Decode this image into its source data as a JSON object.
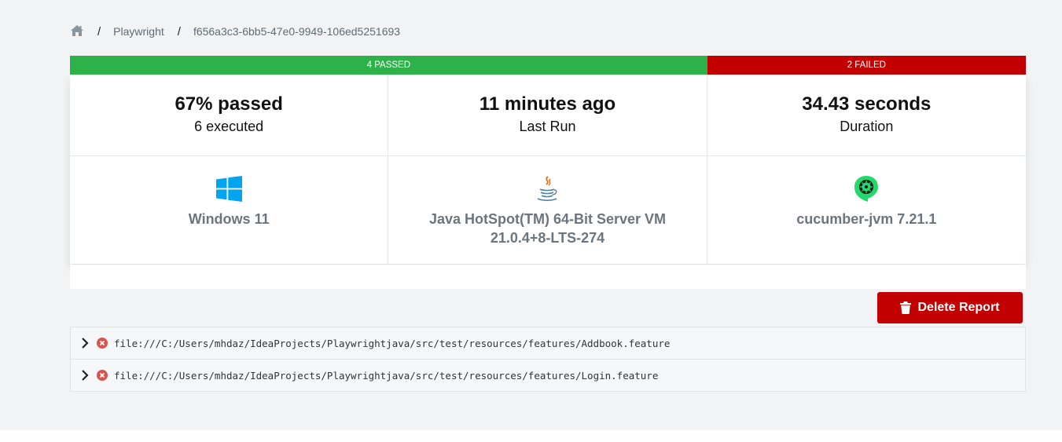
{
  "breadcrumb": {
    "home_icon": "home-icon",
    "project": "Playwright",
    "report_id": "f656a3c3-6bb5-47e0-9949-106ed5251693",
    "separator": "/"
  },
  "status_bar": {
    "passed_label": "4 PASSED",
    "failed_label": "2 FAILED",
    "passed_count": 4,
    "failed_count": 2,
    "passed_color": "#2db24a",
    "failed_color": "#c20000"
  },
  "stats": {
    "pass_rate": "67% passed",
    "executed": "6 executed",
    "last_run": "11 minutes ago",
    "last_run_label": "Last Run",
    "duration": "34.43 seconds",
    "duration_label": "Duration"
  },
  "environment": {
    "os": {
      "icon": "windows-icon",
      "label": "Windows 11"
    },
    "jvm": {
      "icon": "java-icon",
      "label": "Java HotSpot(TM) 64-Bit Server VM",
      "version": "21.0.4+8-LTS-274"
    },
    "runner": {
      "icon": "cucumber-icon",
      "label": "cucumber-jvm 7.21.1"
    }
  },
  "actions": {
    "delete_label": "Delete Report",
    "delete_icon": "trash-icon",
    "delete_color": "#c20000"
  },
  "features": [
    {
      "path": "file:///C:/Users/mhdaz/IdeaProjects/Playwrightjava/src/test/resources/features/Addbook.feature",
      "status": "failed"
    },
    {
      "path": "file:///C:/Users/mhdaz/IdeaProjects/Playwrightjava/src/test/resources/features/Login.feature",
      "status": "failed"
    }
  ]
}
